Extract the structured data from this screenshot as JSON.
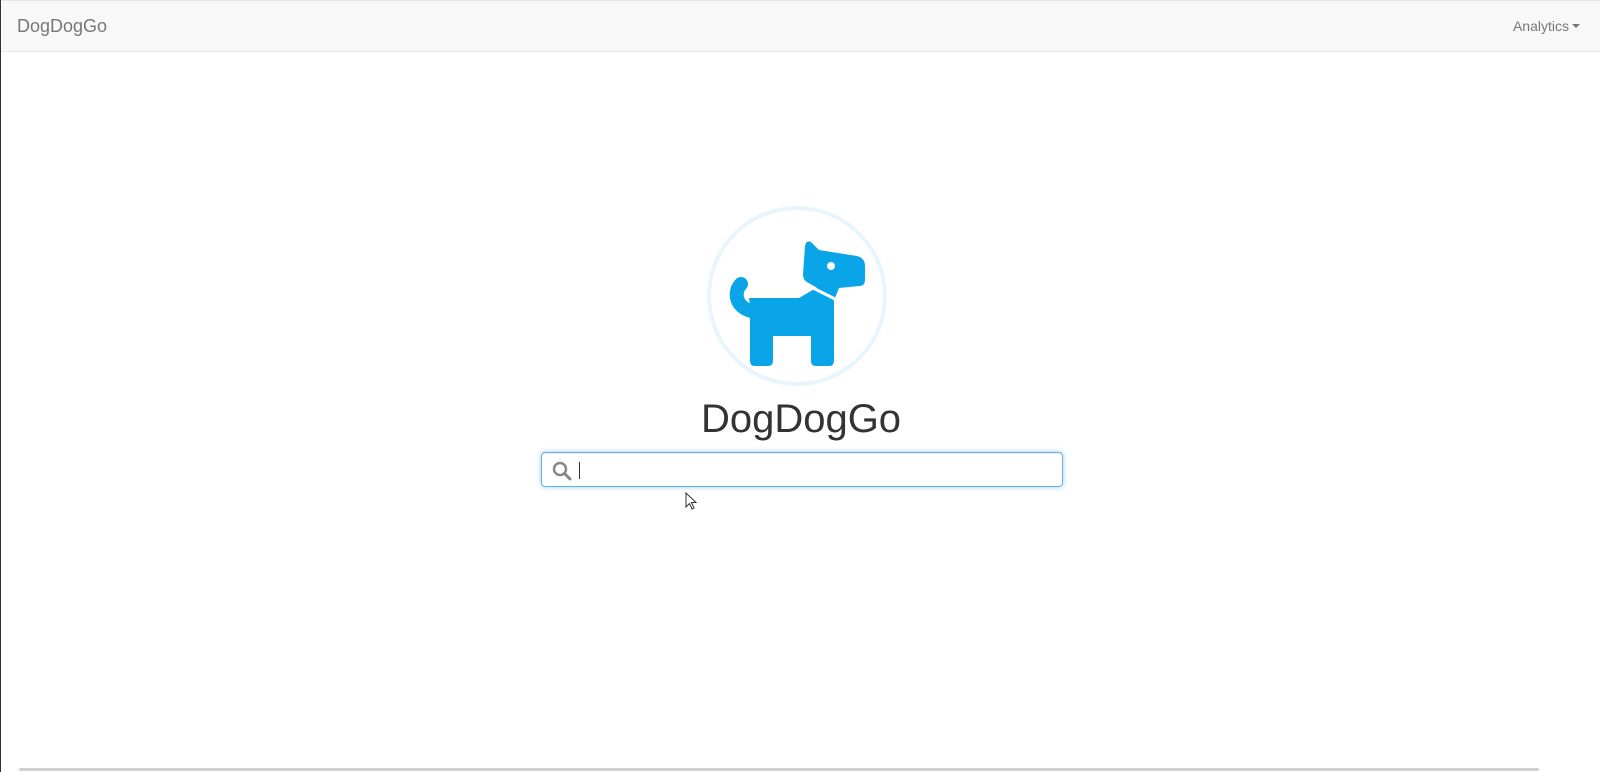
{
  "navbar": {
    "brand": "DogDogGo",
    "menu_label": "Analytics"
  },
  "hero": {
    "logo_icon": "dog-icon",
    "title": "DogDogGo"
  },
  "search": {
    "value": "",
    "placeholder": "",
    "icon": "search-icon"
  },
  "colors": {
    "brand_blue": "#0aa5e8",
    "focus_border": "#66afe9",
    "navbar_bg": "#f8f8f8",
    "navbar_text": "#777777"
  }
}
